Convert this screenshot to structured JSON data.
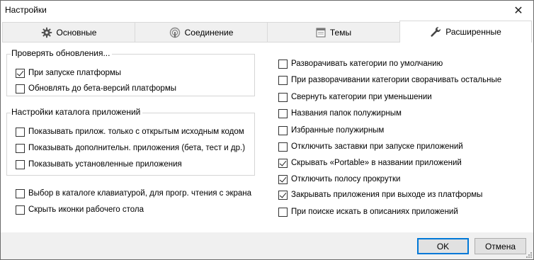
{
  "window": {
    "title": "Настройки",
    "close_glyph": "✕"
  },
  "tabs": [
    {
      "label": "Основные",
      "icon": "gear-icon",
      "active": false
    },
    {
      "label": "Соединение",
      "icon": "connection-icon",
      "active": false
    },
    {
      "label": "Темы",
      "icon": "themes-icon",
      "active": false
    },
    {
      "label": "Расширенные",
      "icon": "wrench-icon",
      "active": true
    }
  ],
  "updates_group": {
    "legend": "Проверять обновления...",
    "items": [
      {
        "label": "При запуске платформы",
        "checked": true
      },
      {
        "label": "Обновлять до бета-версий платформы",
        "checked": false
      }
    ]
  },
  "catalog_group": {
    "legend": "Настройки каталога приложений",
    "items": [
      {
        "label": "Показывать прилож. только с открытым исходным кодом",
        "checked": false
      },
      {
        "label": "Показывать дополнительн. приложения (бета, тест и др.)",
        "checked": false
      },
      {
        "label": "Показывать установленные приложения",
        "checked": false
      }
    ]
  },
  "left_extra": [
    {
      "label": "Выбор в каталоге клавиатурой, для прогр. чтения с экрана",
      "checked": false
    },
    {
      "label": "Скрыть иконки рабочего стола",
      "checked": false
    }
  ],
  "right_options": [
    {
      "label": "Разворачивать категории по умолчанию",
      "checked": false
    },
    {
      "label": "При разворачивании категории сворачивать остальные",
      "checked": false
    },
    {
      "label": "Свернуть категории при уменьшении",
      "checked": false
    },
    {
      "label": "Названия папок полужирным",
      "checked": false
    },
    {
      "label": "Избранные полужирным",
      "checked": false
    },
    {
      "label": "Отключить заставки при запуске приложений",
      "checked": false
    },
    {
      "label": "Скрывать «Portable» в названии приложений",
      "checked": true
    },
    {
      "label": "Отключить полосу прокрутки",
      "checked": true
    },
    {
      "label": "Закрывать приложения при выходе из платформы",
      "checked": true
    },
    {
      "label": "При поиске искать в описаниях приложений",
      "checked": false
    }
  ],
  "footer": {
    "ok_label": "OK",
    "cancel_label": "Отмена"
  },
  "colors": {
    "accent": "#0078d7",
    "tab_bg": "#f0f0f0",
    "border": "#d5d5d5"
  }
}
